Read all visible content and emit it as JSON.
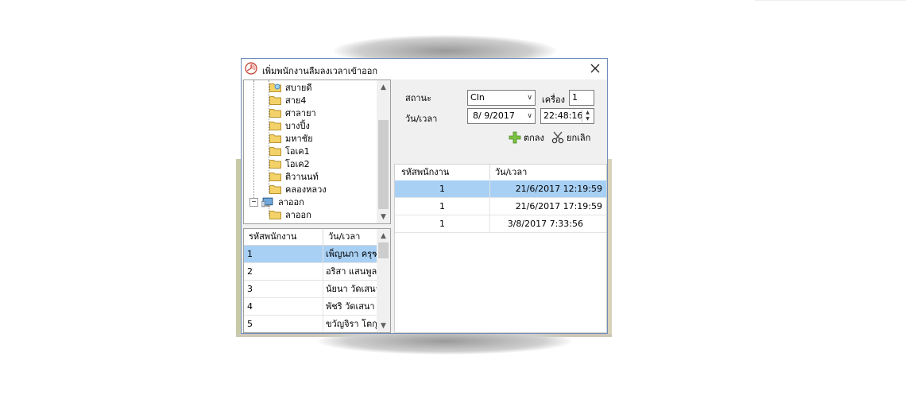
{
  "window": {
    "title": "เพิ่มพนักงานลืมลงเวลาเข้าออก",
    "close_glyph": "✕"
  },
  "tree": {
    "items": [
      {
        "label": "สบายดี",
        "icon": "folder-open-icon",
        "level": 2
      },
      {
        "label": "สาย4",
        "icon": "folder-icon",
        "level": 2
      },
      {
        "label": "ศาลายา",
        "icon": "folder-icon",
        "level": 2
      },
      {
        "label": "บางปิ้ง",
        "icon": "folder-icon",
        "level": 2
      },
      {
        "label": "มหาชัย",
        "icon": "folder-icon",
        "level": 2
      },
      {
        "label": "โอเค1",
        "icon": "folder-icon",
        "level": 2
      },
      {
        "label": "โอเค2",
        "icon": "folder-icon",
        "level": 2
      },
      {
        "label": "ติวานนท์",
        "icon": "folder-icon",
        "level": 2
      },
      {
        "label": "คลองหลวง",
        "icon": "folder-icon",
        "level": 2
      },
      {
        "label": "ลาออก",
        "icon": "computer-icon",
        "level": 1,
        "expander": "−"
      },
      {
        "label": "ลาออก",
        "icon": "folder-icon",
        "level": 2
      }
    ]
  },
  "employees": {
    "headers": [
      "รหัสพนักงาน",
      "วัน/เวลา"
    ],
    "rows": [
      {
        "id": "1",
        "name": "เพ็ญนภา ครุฑ",
        "selected": true
      },
      {
        "id": "2",
        "name": "อริสา แสนพูล",
        "selected": false
      },
      {
        "id": "3",
        "name": "นัยนา วัดเสนา",
        "selected": false
      },
      {
        "id": "4",
        "name": "พัชริ วัดเสนา",
        "selected": false
      },
      {
        "id": "5",
        "name": "ขวัญจิรา โตกุล",
        "selected": false
      }
    ]
  },
  "form": {
    "status_label": "สถานะ",
    "status_value": "CIn",
    "machine_label": "เครื่อง",
    "machine_value": "1",
    "datetime_label": "วัน/เวลา",
    "date_value": "8/ 9/2017",
    "time_value": "22:48:16",
    "ok_label": "ตกลง",
    "cancel_label": "ยกเลิก"
  },
  "times": {
    "headers": [
      "รหัสพนักงาน",
      "วัน/เวลา"
    ],
    "rows": [
      {
        "id": "1",
        "datetime": "21/6/2017 12:19:59",
        "selected": true
      },
      {
        "id": "1",
        "datetime": "21/6/2017 17:19:59",
        "selected": false
      },
      {
        "id": "1",
        "datetime": "3/8/2017 7:33:56",
        "selected": false
      }
    ]
  },
  "colors": {
    "selection": "#a8d0f5",
    "window_border": "#6f8db8",
    "folder": "#f4d26a"
  }
}
